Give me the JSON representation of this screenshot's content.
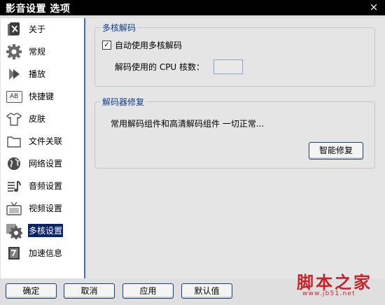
{
  "window": {
    "title": "影音设置 选项",
    "close_glyph": "×"
  },
  "sidebar": {
    "items": [
      {
        "label": "关于",
        "icon": "about-icon"
      },
      {
        "label": "常规",
        "icon": "gear-icon"
      },
      {
        "label": "播放",
        "icon": "play-icon"
      },
      {
        "label": "快捷键",
        "icon": "shortcut-icon"
      },
      {
        "label": "皮肤",
        "icon": "skin-icon"
      },
      {
        "label": "文件关联",
        "icon": "folder-icon"
      },
      {
        "label": "网络设置",
        "icon": "globe-icon"
      },
      {
        "label": "音频设置",
        "icon": "audio-icon"
      },
      {
        "label": "视频设置",
        "icon": "tv-icon"
      },
      {
        "label": "多核设置",
        "icon": "multicore-icon"
      },
      {
        "label": "加速信息",
        "icon": "accelerate-icon"
      }
    ],
    "active": "多核设置",
    "shortcut_icon_text": "AB"
  },
  "multicore": {
    "legend": "多核解码",
    "checkbox_label": "自动使用多核解码",
    "checkbox_checked": true,
    "checkmark": "✓",
    "cores_label": "解码使用的 CPU 核数：",
    "cores_value": ""
  },
  "repair": {
    "legend": "解码器修复",
    "status": "常用解码组件和高清解码组件 一切正常...",
    "button": "智能修复"
  },
  "buttons": {
    "ok": "确定",
    "cancel": "取消",
    "apply": "应用",
    "default": "默认值"
  },
  "watermark": {
    "text": "脚本之家",
    "url": "www.jb51.net"
  },
  "colors": {
    "accent": "#0a246a",
    "legend": "#0d3c8a",
    "watermark": "#c7232d"
  }
}
